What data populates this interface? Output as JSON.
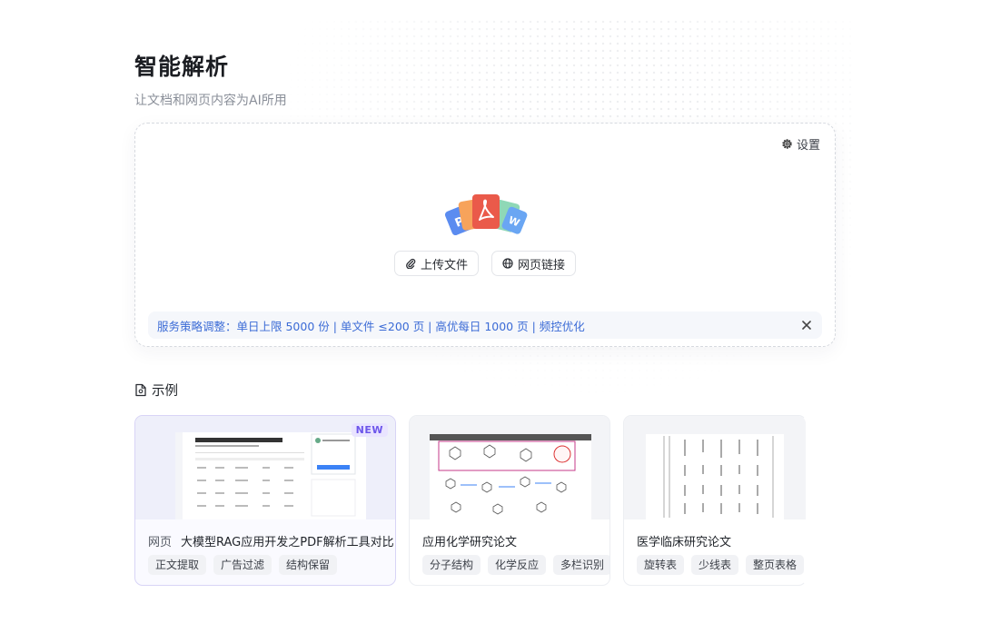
{
  "header": {
    "title": "智能解析",
    "subtitle": "让文档和网页内容为AI所用"
  },
  "upload": {
    "settings_label": "设置",
    "settings_icon": "gear-icon",
    "upload_file_label": "上传文件",
    "upload_file_icon": "paperclip-icon",
    "web_link_label": "网页链接",
    "web_link_icon": "globe-icon",
    "notice_text": "服务策略调整：单日上限 5000 份 | 单文件 ≤200 页 | 高优每日 1000 页 | 频控优化",
    "accent_color": "#3b6bd6"
  },
  "examples": {
    "heading": "示例",
    "items": [
      {
        "badge": "NEW",
        "type": "网页",
        "title": "大模型RAG应用开发之PDF解析工具对比",
        "tags": [
          "正文提取",
          "广告过滤",
          "结构保留"
        ]
      },
      {
        "title": "应用化学研究论文",
        "tags": [
          "分子结构",
          "化学反应",
          "多栏识别"
        ]
      },
      {
        "title": "医学临床研究论文",
        "tags": [
          "旋转表",
          "少线表",
          "整页表格"
        ]
      }
    ]
  }
}
